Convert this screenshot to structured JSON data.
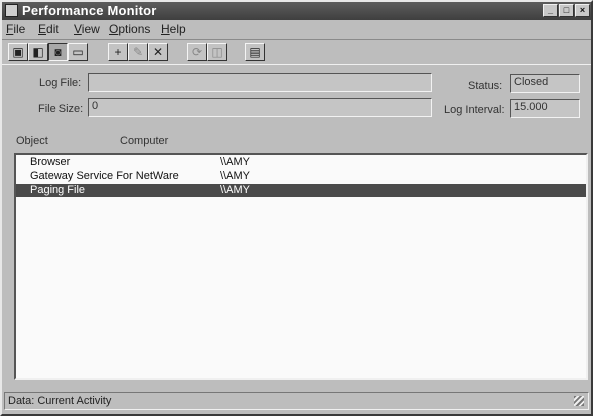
{
  "window": {
    "title": "Performance Monitor"
  },
  "title_buttons": {
    "minimize": "_",
    "maximize": "□",
    "close": "×"
  },
  "menu": {
    "items": [
      "File",
      "Edit",
      "View",
      "Options",
      "Help"
    ]
  },
  "toolbar": {
    "tools": [
      {
        "icon": "chart-view-icon",
        "glyph": "▣"
      },
      {
        "icon": "alert-view-icon",
        "glyph": "◧"
      },
      {
        "icon": "log-view-icon",
        "glyph": "◙"
      },
      {
        "icon": "report-view-icon",
        "glyph": "▭"
      },
      {
        "icon": "add-icon",
        "glyph": "+"
      },
      {
        "icon": "edit-icon",
        "glyph": "✎"
      },
      {
        "icon": "delete-icon",
        "glyph": "✕"
      },
      {
        "icon": "update-icon",
        "glyph": "⟳"
      },
      {
        "icon": "bookmark-icon",
        "glyph": "◫"
      },
      {
        "icon": "options-icon",
        "glyph": "▤"
      }
    ]
  },
  "log": {
    "file_label": "Log File:",
    "file_value": "",
    "size_label": "File Size:",
    "size_value": "0",
    "status_label": "Status:",
    "status_value": "Closed",
    "interval_label": "Log Interval:",
    "interval_value": "15.000"
  },
  "list": {
    "headers": {
      "object": "Object",
      "computer": "Computer"
    },
    "rows": [
      {
        "object": "Browser",
        "computer": "\\\\AMY"
      },
      {
        "object": "Gateway Service For NetWare",
        "computer": "\\\\AMY"
      },
      {
        "object": "Paging File",
        "computer": "\\\\AMY"
      }
    ],
    "selected_index": 2
  },
  "statusbar": {
    "text": "Data: Current Activity"
  }
}
